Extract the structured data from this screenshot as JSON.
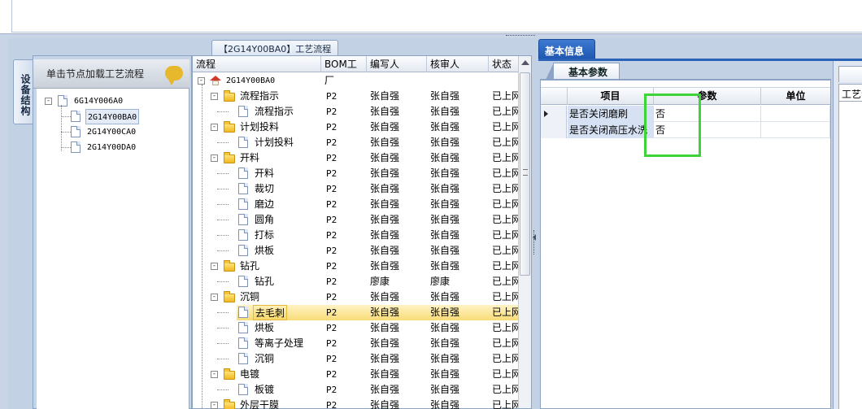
{
  "left_panel": {
    "vertical_tab": "设备结构",
    "hint": "单击节点加载工艺流程",
    "tree": [
      {
        "label": "6G14Y006A0",
        "level": 0,
        "expander": "-",
        "selected": false
      },
      {
        "label": "2G14Y00BA0",
        "level": 1,
        "selected": true
      },
      {
        "label": "2G14Y00CA0",
        "level": 1,
        "selected": false
      },
      {
        "label": "2G14Y00DA0",
        "level": 1,
        "selected": false
      }
    ]
  },
  "middle_panel": {
    "tab_title": "【2G14Y00BA0】工艺流程",
    "columns": [
      "流程",
      "BOM工厂",
      "编写人",
      "核审人",
      "状态"
    ],
    "rows": [
      {
        "level": 0,
        "icon": "home",
        "expander": "-",
        "label": "2G14Y00BA0",
        "code": true,
        "bom": "",
        "author": "",
        "reviewer": "",
        "status": ""
      },
      {
        "level": 1,
        "icon": "folder",
        "expander": "-",
        "label": "流程指示",
        "bom": "P2",
        "author": "张自强",
        "reviewer": "张自强",
        "status": "已上网"
      },
      {
        "level": 2,
        "icon": "doc",
        "label": "流程指示",
        "bom": "P2",
        "author": "张自强",
        "reviewer": "张自强",
        "status": "已上网"
      },
      {
        "level": 1,
        "icon": "folder",
        "expander": "-",
        "label": "计划投料",
        "bom": "P2",
        "author": "张自强",
        "reviewer": "张自强",
        "status": "已上网"
      },
      {
        "level": 2,
        "icon": "doc",
        "label": "计划投料",
        "bom": "P2",
        "author": "张自强",
        "reviewer": "张自强",
        "status": "已上网"
      },
      {
        "level": 1,
        "icon": "folder",
        "expander": "-",
        "label": "开料",
        "bom": "P2",
        "author": "张自强",
        "reviewer": "张自强",
        "status": "已上网"
      },
      {
        "level": 2,
        "icon": "doc",
        "label": "开料",
        "bom": "P2",
        "author": "张自强",
        "reviewer": "张自强",
        "status": "已上网"
      },
      {
        "level": 2,
        "icon": "doc",
        "label": "裁切",
        "bom": "P2",
        "author": "张自强",
        "reviewer": "张自强",
        "status": "已上网"
      },
      {
        "level": 2,
        "icon": "doc",
        "label": "磨边",
        "bom": "P2",
        "author": "张自强",
        "reviewer": "张自强",
        "status": "已上网"
      },
      {
        "level": 2,
        "icon": "doc",
        "label": "圆角",
        "bom": "P2",
        "author": "张自强",
        "reviewer": "张自强",
        "status": "已上网"
      },
      {
        "level": 2,
        "icon": "doc",
        "label": "打标",
        "bom": "P2",
        "author": "张自强",
        "reviewer": "张自强",
        "status": "已上网"
      },
      {
        "level": 2,
        "icon": "doc",
        "label": "烘板",
        "bom": "P2",
        "author": "张自强",
        "reviewer": "张自强",
        "status": "已上网"
      },
      {
        "level": 1,
        "icon": "folder",
        "expander": "-",
        "label": "钻孔",
        "bom": "P2",
        "author": "张自强",
        "reviewer": "张自强",
        "status": "已上网"
      },
      {
        "level": 2,
        "icon": "doc",
        "label": "钻孔",
        "bom": "P2",
        "author": "廖康",
        "reviewer": "廖康",
        "status": "已上网"
      },
      {
        "level": 1,
        "icon": "folder",
        "expander": "-",
        "label": "沉铜",
        "bom": "P2",
        "author": "张自强",
        "reviewer": "张自强",
        "status": "已上网"
      },
      {
        "level": 2,
        "icon": "doc",
        "label": "去毛刺",
        "bom": "P2",
        "author": "张自强",
        "reviewer": "张自强",
        "status": "已上网",
        "selected": true
      },
      {
        "level": 2,
        "icon": "doc",
        "label": "烘板",
        "bom": "P2",
        "author": "张自强",
        "reviewer": "张自强",
        "status": "已上网"
      },
      {
        "level": 2,
        "icon": "doc",
        "label": "等离子处理",
        "bom": "P2",
        "author": "张自强",
        "reviewer": "张自强",
        "status": "已上网"
      },
      {
        "level": 2,
        "icon": "doc",
        "label": "沉铜",
        "bom": "P2",
        "author": "张自强",
        "reviewer": "张自强",
        "status": "已上网"
      },
      {
        "level": 1,
        "icon": "folder",
        "expander": "-",
        "label": "电镀",
        "bom": "P2",
        "author": "张自强",
        "reviewer": "张自强",
        "status": "已上网"
      },
      {
        "level": 2,
        "icon": "doc",
        "label": "板镀",
        "bom": "P2",
        "author": "张自强",
        "reviewer": "张自强",
        "status": "已上网"
      },
      {
        "level": 1,
        "icon": "folder",
        "expander": "-",
        "label": "外层干膜",
        "bom": "P2",
        "author": "张自强",
        "reviewer": "张自强",
        "status": "已上网"
      }
    ]
  },
  "right_panel": {
    "main_tab": "基本信息",
    "sub_tab": "基本参数",
    "columns": [
      "项目",
      "参数",
      "单位"
    ],
    "rows": [
      {
        "name": "是否关闭磨刷",
        "value": "否",
        "unit": "",
        "current": true
      },
      {
        "name": "是否关闭高压水洗",
        "value": "否",
        "unit": "",
        "current": false
      }
    ],
    "side_header": "工艺参数",
    "highlight_color": "#3fd33a"
  }
}
